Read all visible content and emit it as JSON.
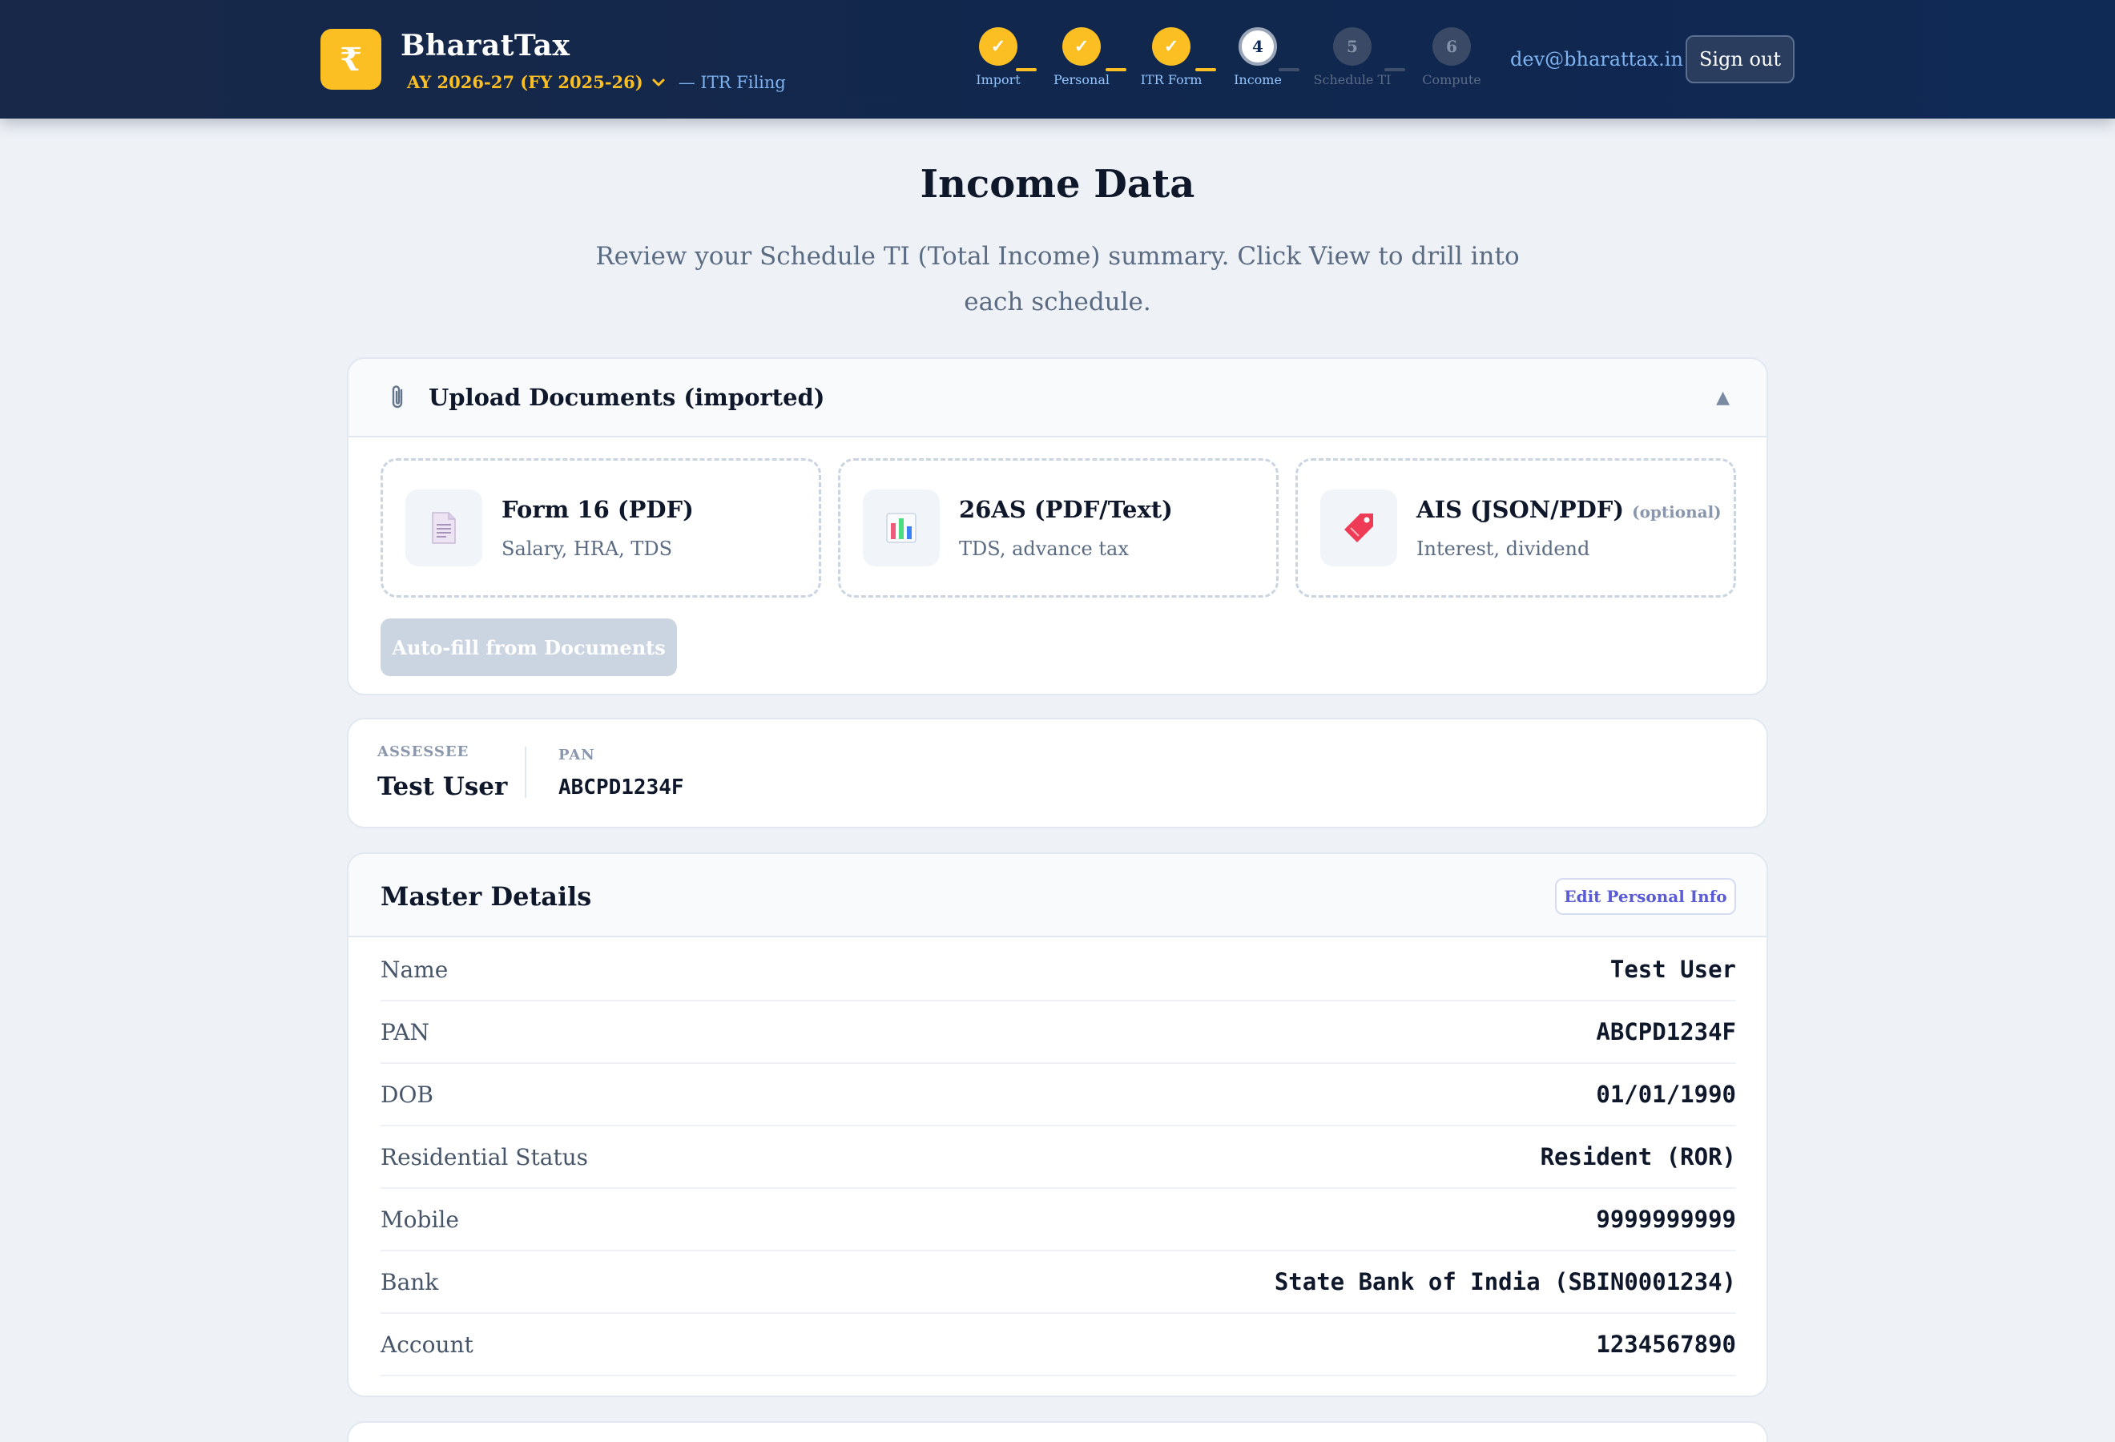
{
  "header": {
    "logo_glyph": "₹",
    "brand": "BharatTax",
    "assessment_year": "AY 2026-27 (FY 2025-26)",
    "suffix": "— ITR Filing",
    "email": "dev@bharattax.in",
    "sign_out": "Sign out"
  },
  "stepper": [
    {
      "label": "Import",
      "state": "done",
      "glyph": "✓"
    },
    {
      "label": "Personal",
      "state": "done",
      "glyph": "✓"
    },
    {
      "label": "ITR Form",
      "state": "done",
      "glyph": "✓"
    },
    {
      "label": "Income",
      "state": "current",
      "glyph": "4"
    },
    {
      "label": "Schedule TI",
      "state": "todo",
      "glyph": "5"
    },
    {
      "label": "Compute",
      "state": "todo",
      "glyph": "6"
    }
  ],
  "page": {
    "title": "Income Data",
    "subtitle": "Review your Schedule TI (Total Income) summary. Click View to drill into each schedule."
  },
  "upload": {
    "title": "Upload Documents (imported)",
    "collapse_glyph": "▲",
    "docs": [
      {
        "name": "Form 16 (PDF)",
        "desc": "Salary, HRA, TDS",
        "optional": "",
        "icon": "document-icon"
      },
      {
        "name": "26AS (PDF/Text)",
        "desc": "TDS, advance tax",
        "optional": "",
        "icon": "bar-chart-icon"
      },
      {
        "name": "AIS (JSON/PDF)",
        "desc": "Interest, dividend",
        "optional": "(optional)",
        "icon": "tag-icon"
      }
    ],
    "autofill": "Auto-fill from Documents"
  },
  "assessee": {
    "label": "ASSESSEE",
    "name": "Test User",
    "pan_label": "PAN",
    "pan": "ABCPD1234F"
  },
  "master": {
    "title": "Master Details",
    "edit": "Edit Personal Info",
    "rows": [
      {
        "label": "Name",
        "value": "Test User"
      },
      {
        "label": "PAN",
        "value": "ABCPD1234F"
      },
      {
        "label": "DOB",
        "value": "01/01/1990"
      },
      {
        "label": "Residential Status",
        "value": "Resident (ROR)"
      },
      {
        "label": "Mobile",
        "value": "9999999999"
      },
      {
        "label": "Bank",
        "value": "State Bank of India (SBIN0001234)"
      },
      {
        "label": "Account",
        "value": "1234567890"
      }
    ]
  },
  "colors": {
    "accent": "#fbbf24",
    "header_bg": "#10274e",
    "link": "#7fb3f0",
    "edit": "#5b5bd6"
  }
}
